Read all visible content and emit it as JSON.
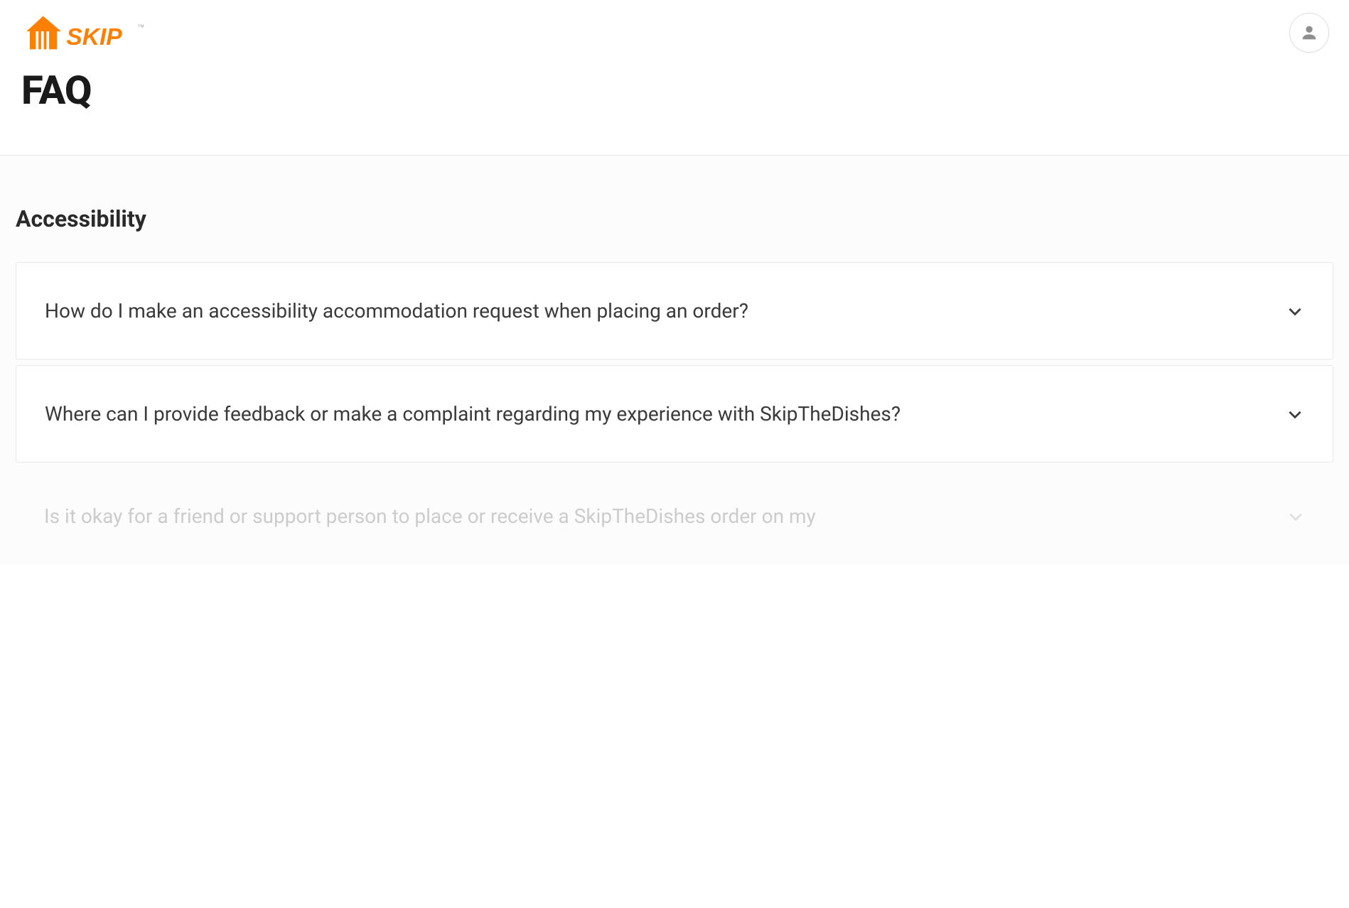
{
  "brand": {
    "name": "SKIP",
    "color": "#ff8000"
  },
  "page": {
    "title": "FAQ"
  },
  "section": {
    "title": "Accessibility",
    "faqs": [
      {
        "question": "How do I make an accessibility accommodation request when placing an order?",
        "expanded": false,
        "faded": false
      },
      {
        "question": "Where can I provide feedback or make a complaint regarding my experience with SkipTheDishes?",
        "expanded": false,
        "faded": false
      },
      {
        "question": "Is it okay for a friend or support person to place or receive a SkipTheDishes order on my",
        "expanded": false,
        "faded": true
      }
    ]
  }
}
